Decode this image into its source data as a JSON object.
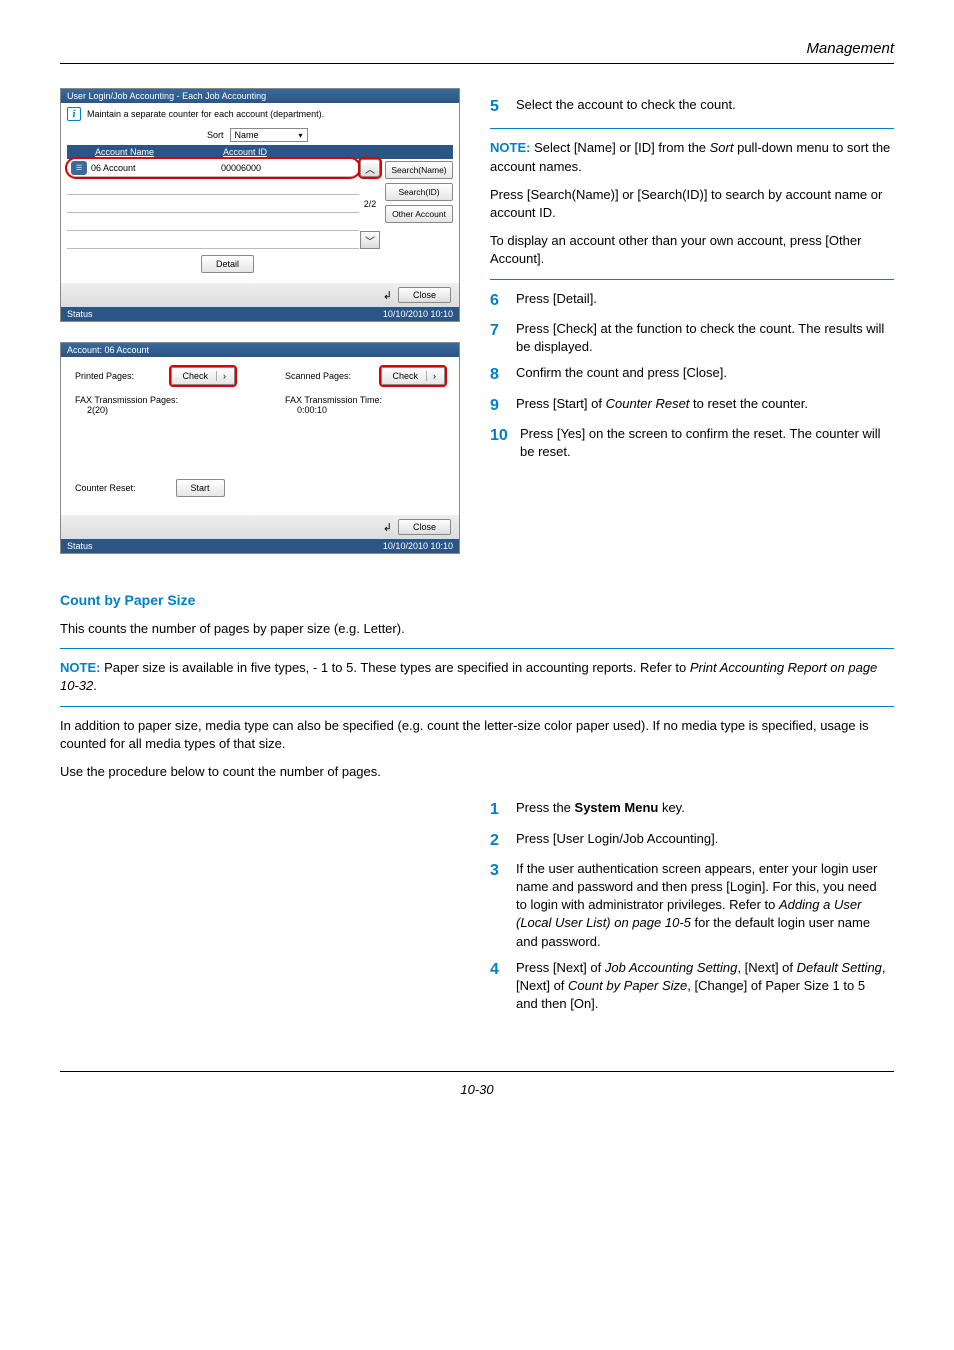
{
  "header": {
    "section": "Management"
  },
  "panel1": {
    "title": "User Login/Job Accounting - Each Job Accounting",
    "subtitle": "Maintain a separate counter for each account (department).",
    "sort_label": "Sort",
    "dropdown_value": "Name",
    "col_account_name": "Account Name",
    "col_account_id": "Account ID",
    "row_name": "06 Account",
    "row_id": "00006000",
    "page_indicator": "2/2",
    "btn_search_name": "Search(Name)",
    "btn_search_id": "Search(ID)",
    "btn_other": "Other Account",
    "btn_detail": "Detail",
    "btn_close": "Close",
    "status": "Status",
    "datetime": "10/10/2010 10:10"
  },
  "panel2": {
    "title": "Account:  06 Account",
    "printed_label": "Printed Pages:",
    "scanned_label": "Scanned Pages:",
    "check": "Check",
    "fax_tp_label": "FAX Transmission Pages:",
    "fax_tp_val": "2(20)",
    "fax_tt_label": "FAX Transmission Time:",
    "fax_tt_val": "0:00:10",
    "counter_reset": "Counter Reset:",
    "start": "Start",
    "close": "Close",
    "status": "Status",
    "datetime": "10/10/2010 10:10"
  },
  "steps_top": {
    "s5": "Select the account to check the count.",
    "note": "Select [Name] or [ID] from the ",
    "note_sort": "Sort",
    "note2": " pull-down menu to sort the account names.",
    "para_search": "Press [Search(Name)] or [Search(ID)] to search by account name or account ID.",
    "para_other": "To display an account other than your own account, press [Other Account].",
    "s6": "Press [Detail].",
    "s7": "Press [Check] at the function to check the count. The results will be displayed.",
    "s8": "Confirm the count and press [Close].",
    "s9_a": "Press [Start] of ",
    "s9_i": "Counter Reset",
    "s9_b": " to reset the counter.",
    "s10": "Press [Yes] on the screen to confirm the reset. The counter will be reset."
  },
  "section2": {
    "title": "Count by Paper Size",
    "intro": "This counts the number of pages by paper size (e.g. Letter).",
    "note_a": "Paper size is available in five types, - 1 to 5. These types are specified in accounting reports. Refer to ",
    "note_i": "Print Accounting Report on page 10-32",
    "para": "In addition to paper size, media type can also be specified (e.g. count the letter-size color paper used). If no media type is specified, usage is counted for all media types of that size.",
    "para2": "Use the procedure below to count the number of pages.",
    "s1_a": "Press the ",
    "s1_b": "System Menu",
    "s1_c": " key.",
    "s2": "Press [User Login/Job Accounting].",
    "s3_a": "If the user authentication screen appears, enter your login user name and password and then press [Login]. For this, you need to login with administrator privileges. Refer to ",
    "s3_i": "Adding a User (Local User List) on page 10-5",
    "s3_b": " for the default login user name and password.",
    "s4_a": "Press [Next] of ",
    "s4_i1": "Job Accounting Setting",
    "s4_b": ", [Next] of ",
    "s4_i2": "Default Setting",
    "s4_c": ", [Next] of ",
    "s4_i3": "Count by Paper Size",
    "s4_d": ", [Change] of Paper Size 1 to 5 and then [On]."
  },
  "footer": {
    "pageno": "10-30"
  },
  "note_label": "NOTE:"
}
